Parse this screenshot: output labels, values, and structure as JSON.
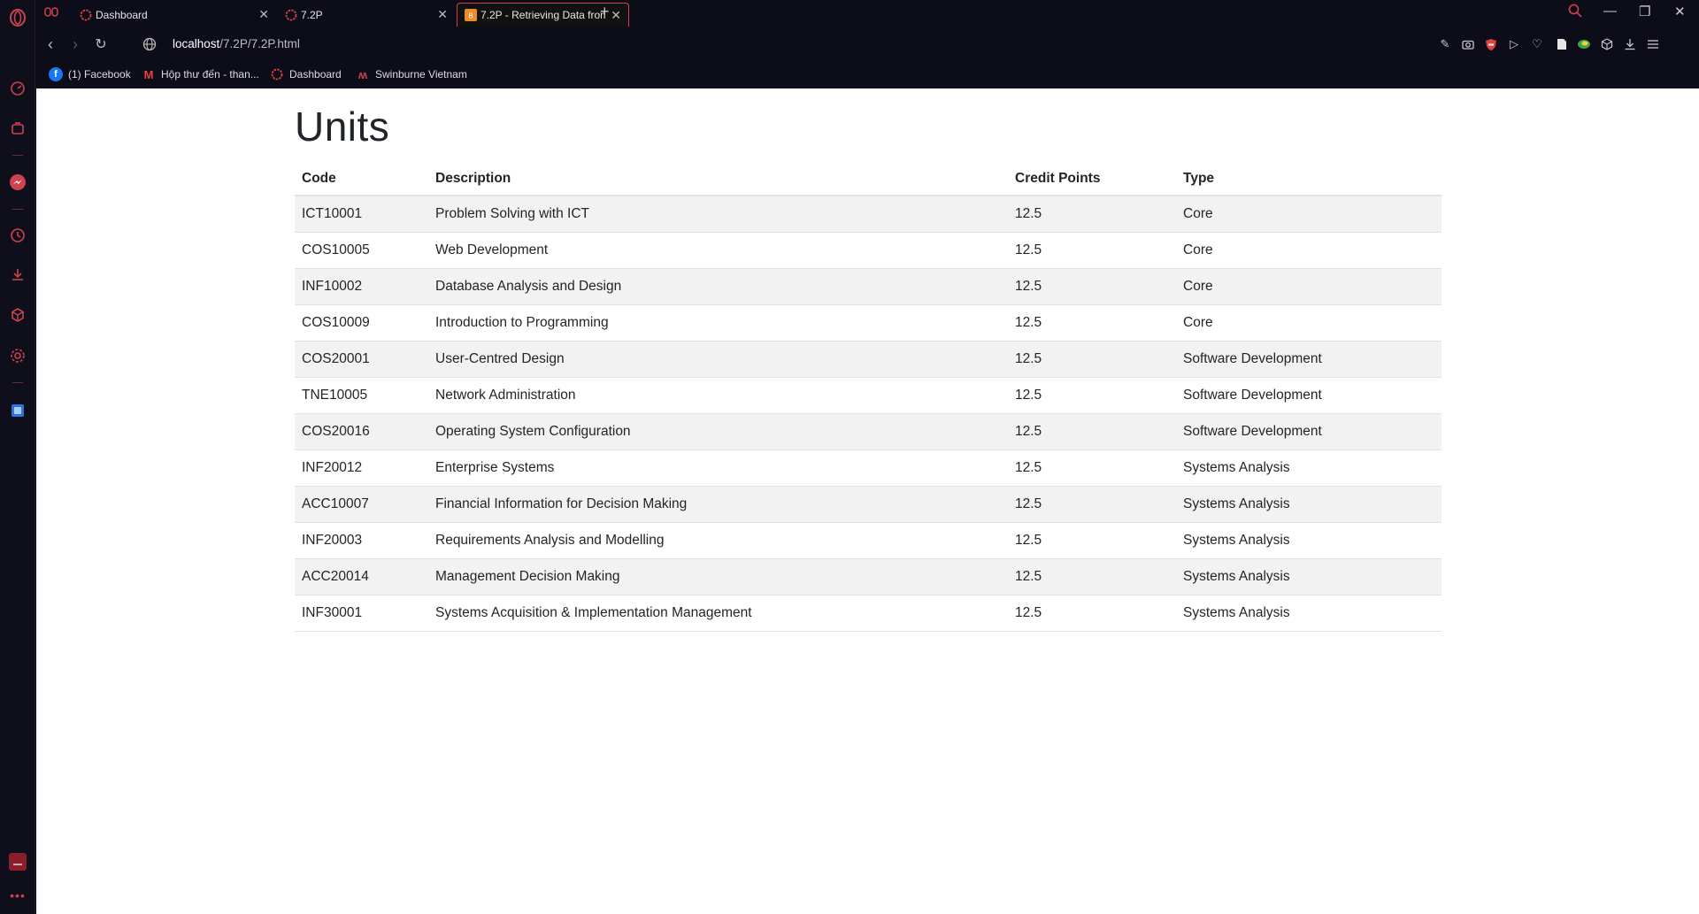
{
  "browser": {
    "tabs": [
      {
        "title": "Dashboard",
        "active": false
      },
      {
        "title": "7.2P",
        "active": false
      },
      {
        "title": "7.2P - Retrieving Data from",
        "active": true
      }
    ],
    "new_tab": "+",
    "url_host": "localhost",
    "url_path": "/7.2P/7.2P.html",
    "bookmarks": [
      {
        "label": "(1) Facebook",
        "icon": "facebook-icon"
      },
      {
        "label": "Hộp thư đến - than...",
        "icon": "gmail-icon"
      },
      {
        "label": "Dashboard",
        "icon": "dashboard-icon"
      },
      {
        "label": "Swinburne Vietnam",
        "icon": "swinburne-icon"
      }
    ],
    "accent": "#d0414f"
  },
  "page": {
    "title": "Units",
    "headers": {
      "code": "Code",
      "description": "Description",
      "credit": "Credit Points",
      "type": "Type"
    },
    "rows": [
      {
        "code": "ICT10001",
        "description": "Problem Solving with ICT",
        "credit": "12.5",
        "type": "Core"
      },
      {
        "code": "COS10005",
        "description": "Web Development",
        "credit": "12.5",
        "type": "Core"
      },
      {
        "code": "INF10002",
        "description": "Database Analysis and Design",
        "credit": "12.5",
        "type": "Core"
      },
      {
        "code": "COS10009",
        "description": "Introduction to Programming",
        "credit": "12.5",
        "type": "Core"
      },
      {
        "code": "COS20001",
        "description": "User-Centred Design",
        "credit": "12.5",
        "type": "Software Development"
      },
      {
        "code": "TNE10005",
        "description": "Network Administration",
        "credit": "12.5",
        "type": "Software Development"
      },
      {
        "code": "COS20016",
        "description": "Operating System Configuration",
        "credit": "12.5",
        "type": "Software Development"
      },
      {
        "code": "INF20012",
        "description": "Enterprise Systems",
        "credit": "12.5",
        "type": "Systems Analysis"
      },
      {
        "code": "ACC10007",
        "description": "Financial Information for Decision Making",
        "credit": "12.5",
        "type": "Systems Analysis"
      },
      {
        "code": "INF20003",
        "description": "Requirements Analysis and Modelling",
        "credit": "12.5",
        "type": "Systems Analysis"
      },
      {
        "code": "ACC20014",
        "description": "Management Decision Making",
        "credit": "12.5",
        "type": "Systems Analysis"
      },
      {
        "code": "INF30001",
        "description": "Systems Acquisition & Implementation Management",
        "credit": "12.5",
        "type": "Systems Analysis"
      }
    ]
  }
}
